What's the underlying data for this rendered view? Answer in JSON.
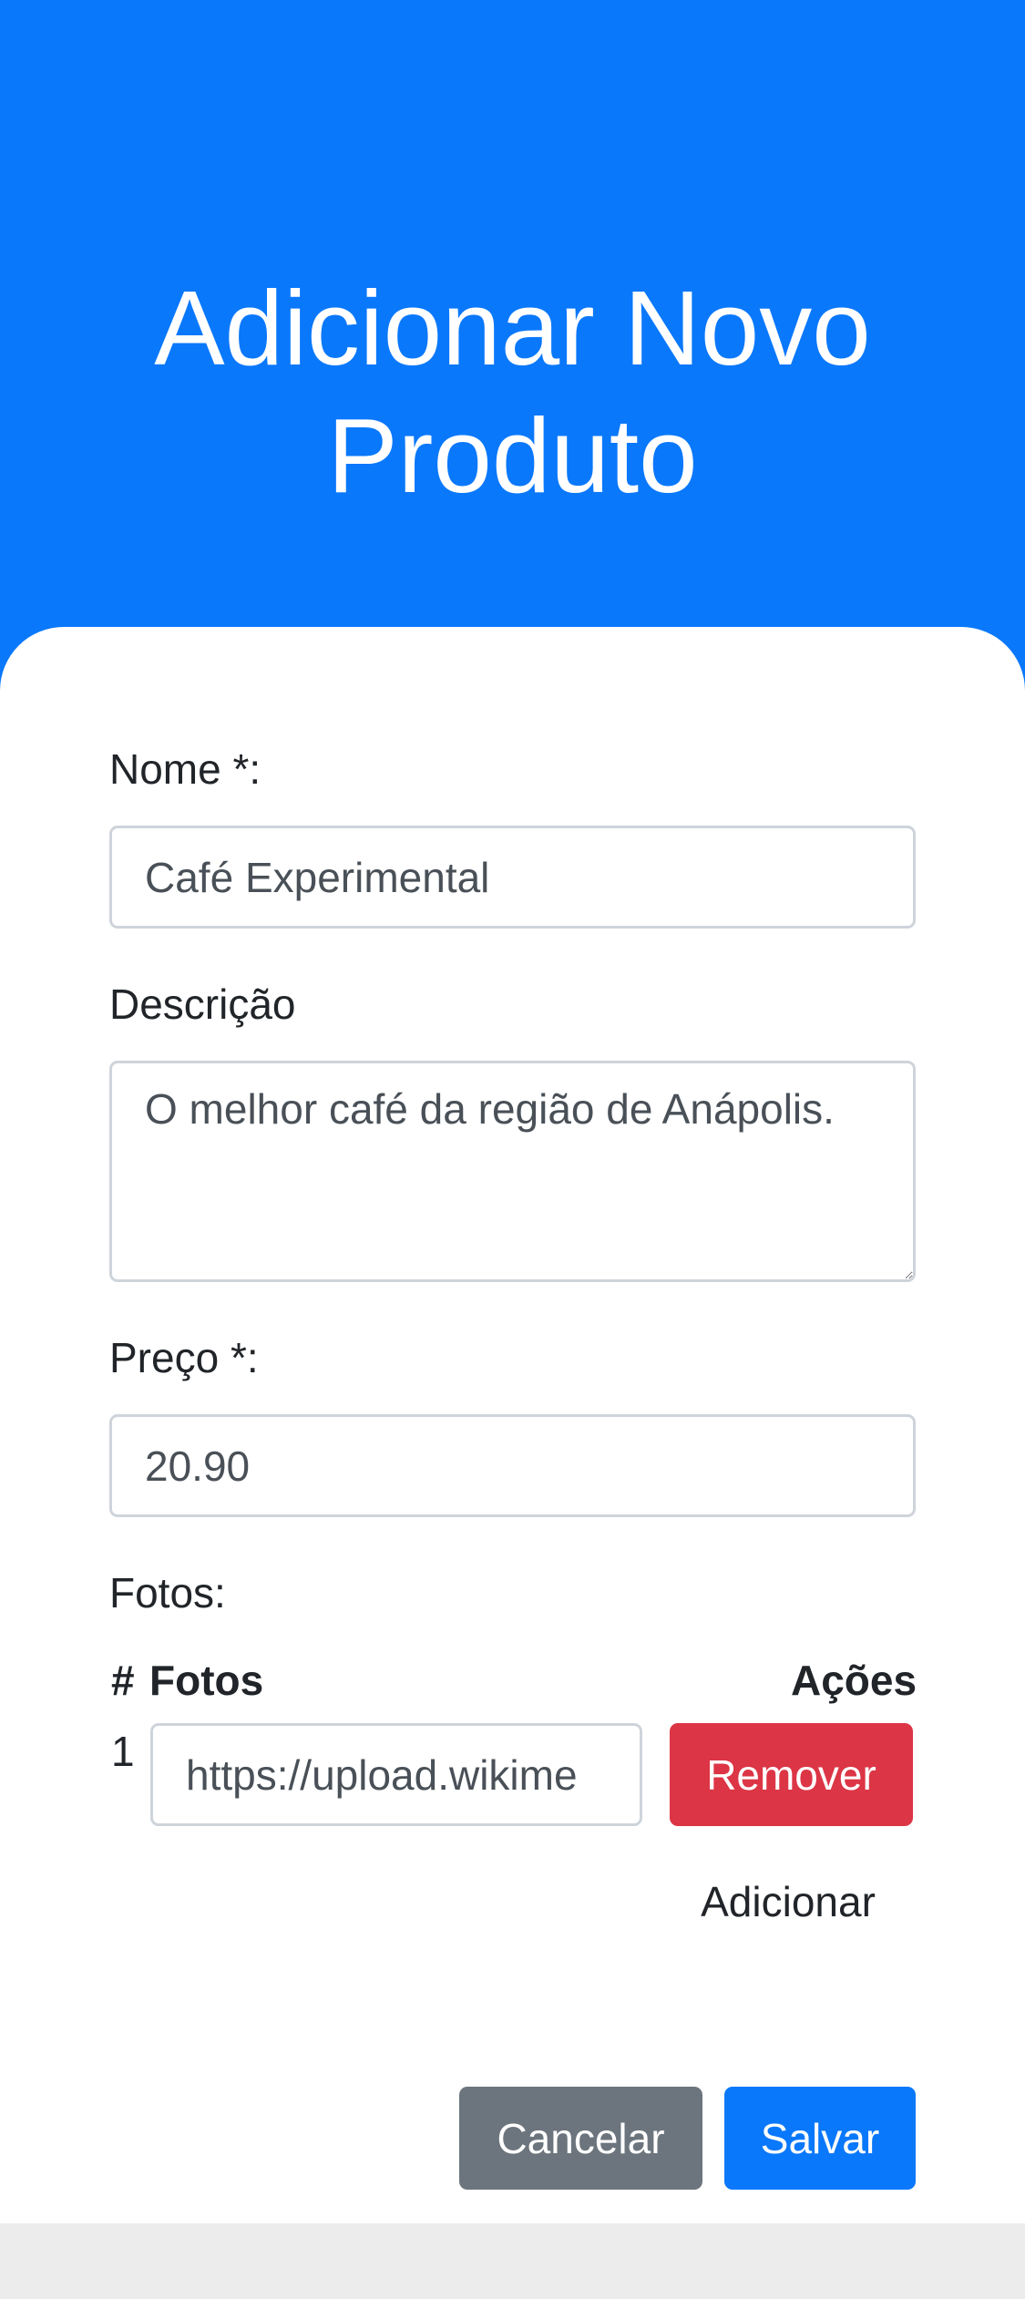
{
  "header": {
    "title": "Adicionar Novo Produto",
    "background_color": "#0a78fb"
  },
  "form": {
    "name": {
      "label": "Nome *:",
      "value": "Café Experimental"
    },
    "description": {
      "label": "Descrição",
      "value": "O melhor café da região de Anápolis."
    },
    "price": {
      "label": "Preço *:",
      "value": "20.90"
    },
    "photos": {
      "label": "Fotos:",
      "columns": [
        "#",
        "Fotos",
        "Ações"
      ],
      "rows": [
        {
          "index": "1",
          "url": "https://upload.wikime",
          "remove_label": "Remover"
        }
      ],
      "add_label": "Adicionar"
    },
    "actions": {
      "cancel_label": "Cancelar",
      "save_label": "Salvar"
    }
  },
  "colors": {
    "primary": "#0a78fb",
    "danger": "#dc3545",
    "secondary": "#6c757d"
  }
}
